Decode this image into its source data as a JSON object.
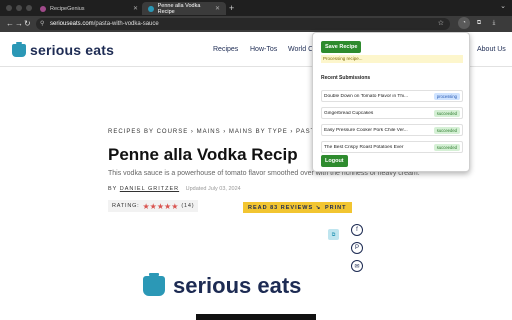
{
  "browser": {
    "tabs": [
      {
        "label": "RecipeGenius",
        "favicon_color": "#a04a8a",
        "active": false
      },
      {
        "label": "Penne alla Vodka Recipe",
        "favicon_color": "#2b98b6",
        "active": true
      }
    ],
    "new_tab": "+",
    "tab_menu": "⌄",
    "back": "←",
    "forward": "→",
    "reload": "↻",
    "url_host": "seriouseats.com",
    "url_path": "/pasta-with-vodka-sauce",
    "bookmark": "☆"
  },
  "site": {
    "logo_text": "serious eats",
    "nav": [
      "Recipes",
      "How-Tos",
      "World C",
      "About Us"
    ],
    "breadcrumbs": "RECIPES BY COURSE › MAINS › MAINS BY TYPE › PASTA M",
    "title": "Penne alla Vodka Recip",
    "description": "This vodka sauce is a powerhouse of tomato flavor smoothed over with the richness of heavy cream.",
    "by": "BY",
    "author": "DANIEL GRITZER",
    "date": "Updated July 03, 2024",
    "rating_label": "RATING:",
    "stars": "★★★★★",
    "rating_count": "(14)",
    "reviews_button": "READ 83 REVIEWS ↘",
    "print_button": "PRINT",
    "share_icons": [
      "f",
      "P",
      "✉"
    ],
    "footer_logo_text": "serious eats"
  },
  "popup": {
    "save_button": "Save Recipe",
    "status": "Processing recipe...",
    "recent_heading": "Recent Submissions",
    "submissions": [
      {
        "name": "Double Down on Tomato Flavor in Thi...",
        "status": "processing"
      },
      {
        "name": "Gingerbread Cupcakes",
        "status": "succeeded"
      },
      {
        "name": "Easy Pressure Cooker Pork Chile Ver...",
        "status": "succeeded"
      },
      {
        "name": "The Best Crispy Roast Potatoes Ever",
        "status": "succeeded"
      }
    ],
    "logout_button": "Logout"
  }
}
